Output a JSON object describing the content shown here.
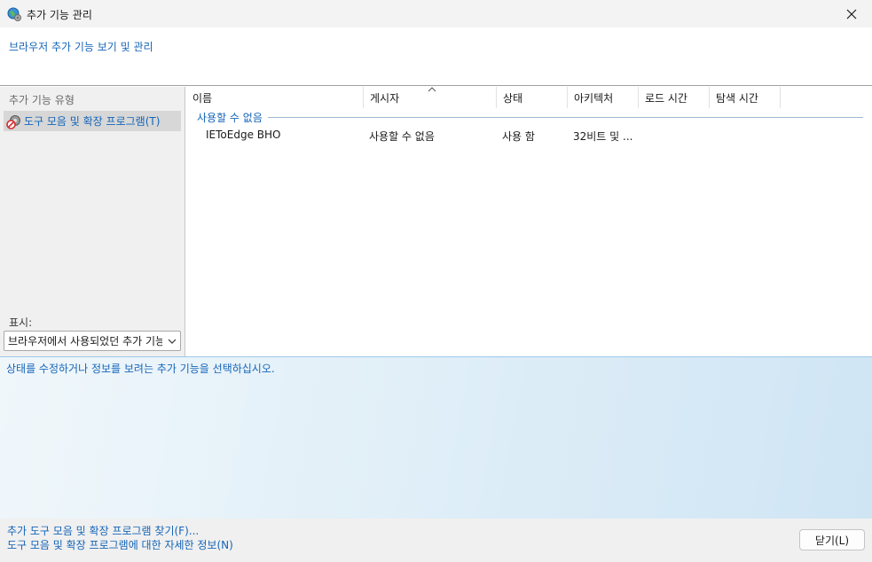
{
  "window": {
    "title": "추가 기능 관리",
    "app_icon": "globe-gear-icon",
    "close_icon": "close-icon"
  },
  "header": {
    "title": "브라우저 추가 기능 보기 및 관리"
  },
  "sidebar": {
    "heading": "추가 기능 유형",
    "items": [
      {
        "label": "도구 모음 및 확장 프로그램(T)",
        "icon": "toolbar-extension-icon",
        "selected": true
      }
    ],
    "show_label": "표시:",
    "show_select_value": "브라우저에서 사용되었던 추가 기능"
  },
  "list": {
    "columns": [
      "이름",
      "게시자",
      "상태",
      "아키텍처",
      "로드 시간",
      "탐색 시간"
    ],
    "sort_indicator": "sort-ascending-icon",
    "group_label": "사용할 수 없음",
    "rows": [
      {
        "name": "IEToEdge BHO",
        "publisher": "사용할 수 없음",
        "status": "사용 함",
        "architecture": "32비트 및 ...",
        "load_time": "",
        "nav_time": ""
      }
    ]
  },
  "details": {
    "text": "상태를 수정하거나 정보를 보려는 추가 기능을 선택하십시오."
  },
  "footer": {
    "link_find": "추가 도구 모음 및 확장 프로그램 찾기(F)...",
    "link_learn": "도구 모음 및 확장 프로그램에 대한 자세한 정보(N)",
    "close_button": "닫기(L)"
  },
  "colors": {
    "accent_link": "#1565b8",
    "selection": "#d7d7d7",
    "details_gradient_start": "#f0f7fb",
    "details_gradient_end": "#cfe5f4"
  }
}
